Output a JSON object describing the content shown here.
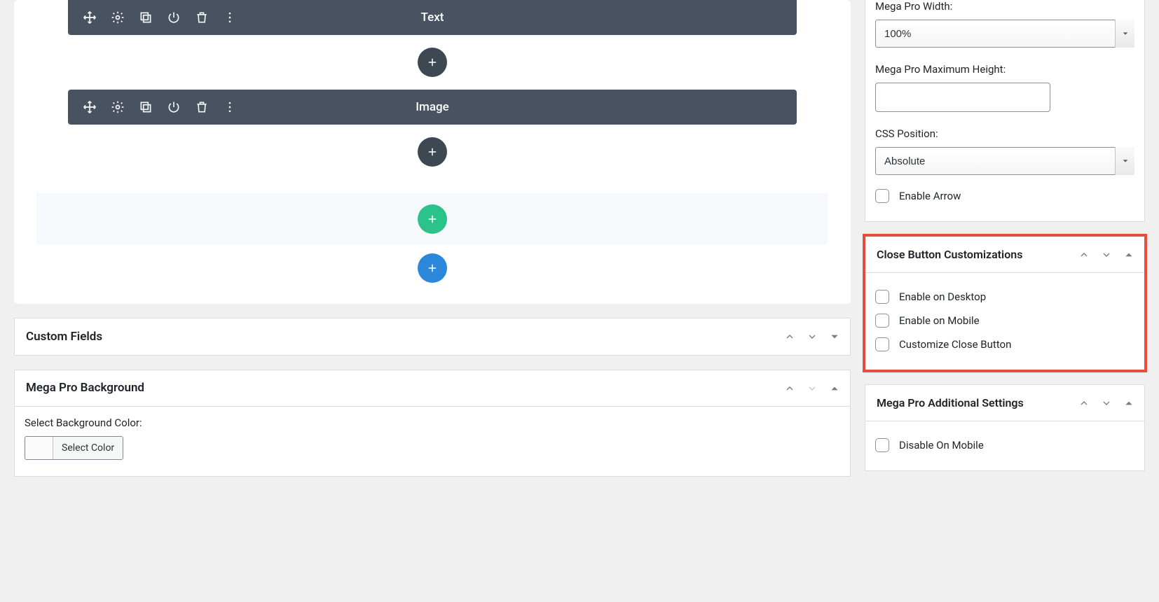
{
  "builder": {
    "modules": [
      {
        "label": "Text"
      },
      {
        "label": "Image"
      }
    ]
  },
  "metaboxes": {
    "custom_fields": {
      "title": "Custom Fields"
    },
    "mega_bg": {
      "title": "Mega Pro Background",
      "select_bg_label": "Select Background Color:",
      "select_color_btn": "Select Color"
    }
  },
  "sidebar": {
    "settings": {
      "width_label": "Mega Pro Width:",
      "width_value": "100%",
      "max_height_label": "Mega Pro Maximum Height:",
      "max_height_value": "",
      "css_pos_label": "CSS Position:",
      "css_pos_value": "Absolute",
      "enable_arrow_label": "Enable Arrow"
    },
    "close_btn": {
      "title": "Close Button Customizations",
      "enable_desktop": "Enable on Desktop",
      "enable_mobile": "Enable on Mobile",
      "customize": "Customize Close Button"
    },
    "additional": {
      "title": "Mega Pro Additional Settings",
      "disable_mobile": "Disable On Mobile"
    }
  }
}
